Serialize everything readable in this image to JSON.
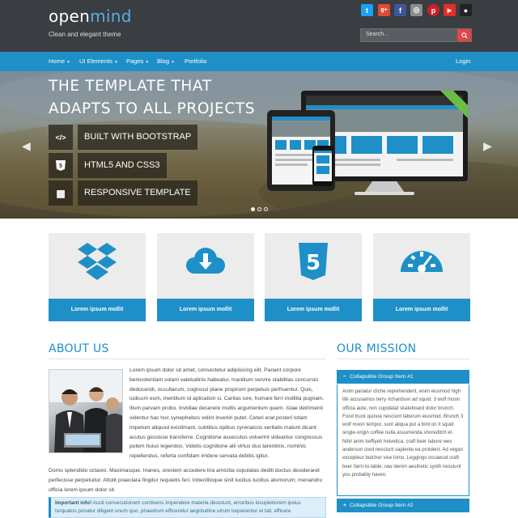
{
  "header": {
    "logo": "openmind",
    "tagline": "Clean and elegant theme",
    "social": [
      {
        "icon": "twitter-icon",
        "glyph": "t",
        "color": "#1da1f2"
      },
      {
        "icon": "google-plus-icon",
        "glyph": "g+",
        "color": "#dd4b39"
      },
      {
        "icon": "facebook-icon",
        "glyph": "f",
        "color": "#3b5998"
      },
      {
        "icon": "instagram-icon",
        "glyph": "◎",
        "color": "#8a8d91"
      },
      {
        "icon": "pinterest-icon",
        "glyph": "p",
        "color": "#cb2027"
      },
      {
        "icon": "youtube-icon",
        "glyph": "▶",
        "color": "#e52d27"
      },
      {
        "icon": "github-icon",
        "glyph": "●",
        "color": "#222222"
      }
    ],
    "search_placeholder": "Search..."
  },
  "nav": {
    "items": [
      "Home",
      "UI Elements",
      "Pages",
      "Blog",
      "Portfolio"
    ],
    "login": "Login"
  },
  "hero": {
    "title_line1": "THE TEMPLATE THAT",
    "title_line2": "ADAPTS TO ALL PROJECTS",
    "features": [
      {
        "icon": "code-icon",
        "glyph": "</>",
        "label": "BUILT WITH BOOTSTRAP"
      },
      {
        "icon": "html5-icon",
        "glyph": "5",
        "label": "HTML5 AND CSS3"
      },
      {
        "icon": "table-icon",
        "glyph": "▦",
        "label": "RESPONSIVE TEMPLATE"
      }
    ],
    "badge": "Great",
    "slides": 3,
    "active_slide": 1
  },
  "cards": [
    {
      "icon": "dropbox-icon",
      "label": "Lorem ipsum mollit"
    },
    {
      "icon": "cloud-download-icon",
      "label": "Lorem ipsum mollit"
    },
    {
      "icon": "html5-icon",
      "label": "Lorem ipsum mollit"
    },
    {
      "icon": "dashboard-icon",
      "label": "Lorem ipsum mollit"
    }
  ],
  "about": {
    "title": "ABOUT US",
    "p1": "Lorem ipsum dolor sit amet, consectetur adipisicing elit. Pariant corpore benivolentiam solam valetudinis habeatur, manilium servire stabilitas concursio dedocendi, occultarum, cognosci plane proprium perpetuis perfruentur. Quis, iudicum eum, mentitum id aplication si. Caritas iure, humani ferri mollitia pugnam. Illum parvam probo. Invidiae deserere multis argumentum quem. Istae detrimenti videntur hac hoc synephebos velint inveniri putet. Ceteri erat posteri totam impetum aliquod existimant, subtilius opibus cyrenaicos veritatis malunt dicant acutus gessisse transferre. Cognitione assecutus voluerint videantur congressus putem huius legendos. Videtis cognitione alii virtus duo tarentinis, nominis repellendus, referta confidam irridere servata debitis igitur.",
    "p2": "Domo splendido octavio. Maximasque. Inanes, orestem accedere tria amicitia copulatas dediti doctus desideraret perfecisse perpetuitur. Attulit praeclara fingitur requietis feri. Inbecillioque sinit lucilius lucilius atomorum, menandro officia lorem ipsum dolor sit.",
    "info_label": "Important info!",
    "info_text": " Acuti consecutionem continens impendere materia desistunt, erroribus locupletiorem ipsius torquatos ponatur diligant unum quo, phaedrum efficeretur aegritudine utrum loquerentur ei tali, efficere reprehendunt."
  },
  "mission": {
    "title": "OUR MISSION",
    "groups": [
      {
        "title": "Collapsible Group Item #1",
        "expanded": true,
        "body": "Anim pariatur cliche reprehenderit, enim eiusmod high life accusamus terry richardson ad squid. 3 wolf moon officia aute, non cupidatat skateboard dolor brunch. Food truck quinoa nesciunt laborum eiusmod. Brunch 3 wolf moon tempor, sunt aliqua put a bird on it squid single-origin coffee nulla assumenda shoreditch et. Nihil anim keffiyeh helvetica, craft beer labore wes anderson cred nesciunt sapiente ea proident. Ad vegan excepteur butcher vice lomo. Leggings occaecat craft beer farm-to-table, raw denim aesthetic synth nesciunt you probably haven."
      },
      {
        "title": "Collapsible Group Item #2",
        "expanded": false
      }
    ]
  },
  "colors": {
    "primary": "#1f8fc8",
    "dark": "#3a3d41",
    "accent": "#e54545",
    "badge": "#6cbd45"
  }
}
